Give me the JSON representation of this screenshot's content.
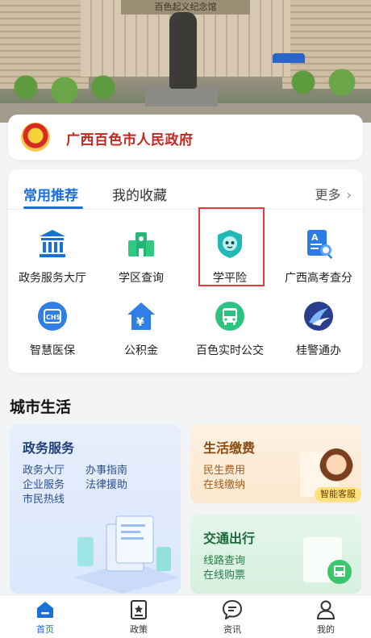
{
  "hero": {
    "sign_text": "百色起义纪念馆"
  },
  "gov": {
    "title": "广西百色市人民政府"
  },
  "recommend": {
    "tabs": [
      "常用推荐",
      "我的收藏"
    ],
    "more": "更多",
    "items": [
      {
        "label": "政务服务大厅",
        "icon": "government-hall-icon"
      },
      {
        "label": "学区查询",
        "icon": "school-district-icon"
      },
      {
        "label": "学平险",
        "icon": "student-insurance-icon"
      },
      {
        "label": "广西高考查分",
        "icon": "exam-score-icon"
      },
      {
        "label": "智慧医保",
        "icon": "medical-insurance-icon"
      },
      {
        "label": "公积金",
        "icon": "housing-fund-icon"
      },
      {
        "label": "百色实时公交",
        "icon": "bus-icon"
      },
      {
        "label": "桂警通办",
        "icon": "police-service-icon"
      }
    ]
  },
  "city": {
    "title": "城市生活",
    "gov_service": {
      "title": "政务服务",
      "links": [
        "政务大厅",
        "办事指南",
        "企业服务",
        "法律援助",
        "市民热线"
      ]
    },
    "life_payment": {
      "title": "生活缴费",
      "lines": [
        "民生费用",
        "在线缴纳"
      ],
      "badge": "智能客服"
    },
    "traffic": {
      "title": "交通出行",
      "lines": [
        "线路查询",
        "在线购票"
      ]
    }
  },
  "nav": {
    "items": [
      {
        "label": "首页",
        "icon": "home-icon"
      },
      {
        "label": "政策",
        "icon": "policy-icon"
      },
      {
        "label": "资讯",
        "icon": "news-icon"
      },
      {
        "label": "我的",
        "icon": "profile-icon"
      }
    ]
  },
  "colors": {
    "accent": "#1b6fd9",
    "gov_red": "#c8261f",
    "highlight": "#e23b3b"
  }
}
